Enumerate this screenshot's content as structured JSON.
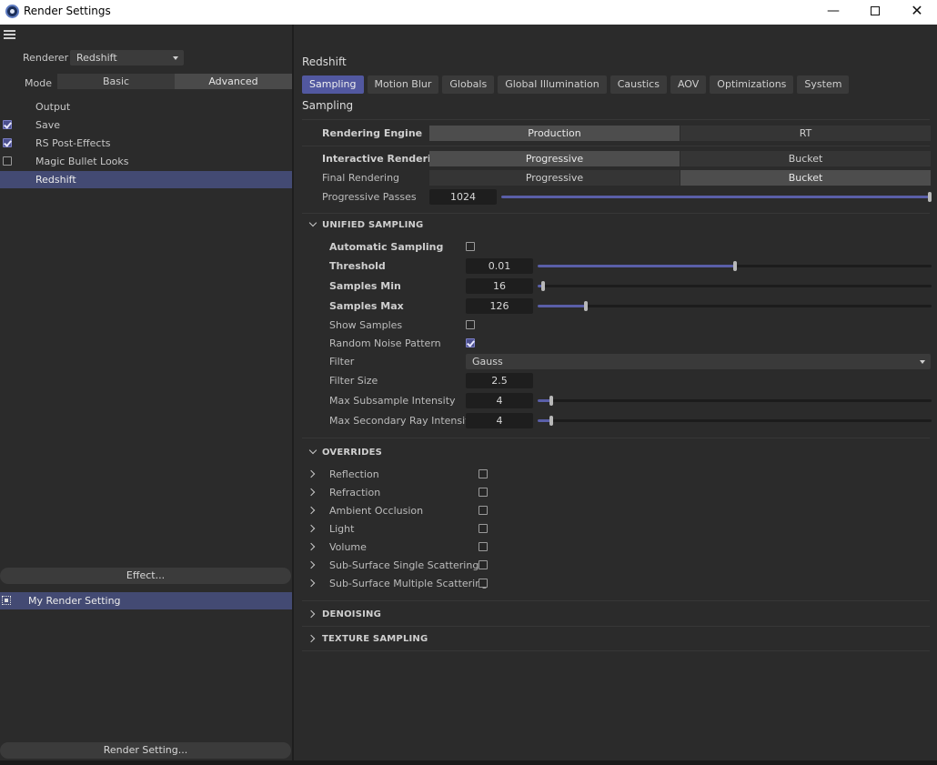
{
  "window": {
    "title": "Render Settings"
  },
  "left": {
    "renderer_label": "Renderer",
    "renderer_value": "Redshift",
    "mode_label": "Mode",
    "mode_options": [
      "Basic",
      "Advanced"
    ],
    "mode_selected": "Advanced",
    "items": [
      {
        "label": "Output",
        "checkbox": null
      },
      {
        "label": "Save",
        "checkbox": true
      },
      {
        "label": "RS Post-Effects",
        "checkbox": true
      },
      {
        "label": "Magic Bullet Looks",
        "checkbox": false
      },
      {
        "label": "Redshift",
        "checkbox": null,
        "selected": true
      }
    ],
    "effect_button": "Effect...",
    "render_setting_name": "My Render Setting",
    "render_setting_button": "Render Setting..."
  },
  "right": {
    "title": "Redshift",
    "tabs": [
      "Sampling",
      "Motion Blur",
      "Globals",
      "Global Illumination",
      "Caustics",
      "AOV",
      "Optimizations",
      "System"
    ],
    "active_tab": "Sampling",
    "section_title": "Sampling",
    "rendering_engine": {
      "label": "Rendering Engine",
      "options": [
        "Production",
        "RT"
      ],
      "selected": "Production"
    },
    "interactive_rendering": {
      "label": "Interactive Rendering",
      "options": [
        "Progressive",
        "Bucket"
      ],
      "selected": "Progressive"
    },
    "final_rendering": {
      "label": "Final Rendering",
      "options": [
        "Progressive",
        "Bucket"
      ],
      "selected": "Bucket"
    },
    "progressive_passes": {
      "label": "Progressive Passes",
      "value": "1024",
      "fraction": 1.0
    },
    "unified_sampling": {
      "header": "UNIFIED SAMPLING",
      "automatic_sampling": {
        "label": "Automatic Sampling",
        "checked": false
      },
      "threshold": {
        "label": "Threshold",
        "value": "0.01",
        "fraction": 0.5
      },
      "samples_min": {
        "label": "Samples Min",
        "value": "16",
        "fraction": 0.01
      },
      "samples_max": {
        "label": "Samples Max",
        "value": "126",
        "fraction": 0.12
      },
      "show_samples": {
        "label": "Show Samples",
        "checked": false
      },
      "random_noise": {
        "label": "Random Noise Pattern",
        "checked": true
      },
      "filter": {
        "label": "Filter",
        "value": "Gauss"
      },
      "filter_size": {
        "label": "Filter Size",
        "value": "2.5"
      },
      "max_subsample": {
        "label": "Max Subsample Intensity",
        "value": "4",
        "fraction": 0.03
      },
      "max_secondary": {
        "label": "Max Secondary Ray Intensity",
        "value": "4",
        "fraction": 0.03
      }
    },
    "overrides": {
      "header": "OVERRIDES",
      "items": [
        "Reflection",
        "Refraction",
        "Ambient Occlusion",
        "Light",
        "Volume",
        "Sub-Surface Single Scattering",
        "Sub-Surface Multiple Scattering"
      ]
    },
    "denoising_header": "DENOISING",
    "texture_sampling_header": "TEXTURE SAMPLING"
  },
  "colors": {
    "accent": "#5258a0",
    "selection": "#434a73",
    "background": "#2b2b2b"
  }
}
